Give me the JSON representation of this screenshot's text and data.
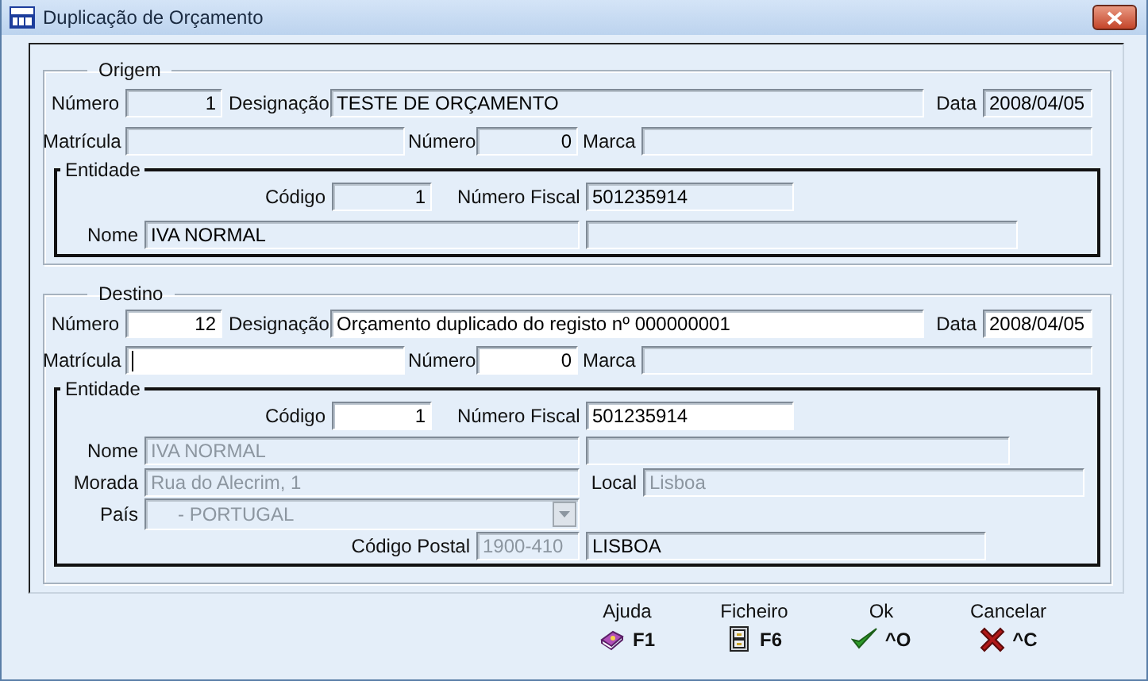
{
  "window": {
    "title": "Duplicação de Orçamento"
  },
  "sections": [
    {
      "title": "Origem",
      "numero": {
        "label": "Número",
        "value": "1",
        "editable": false,
        "disabled": false
      },
      "designacao": {
        "label": "Designação",
        "value": "TESTE DE ORÇAMENTO",
        "editable": false,
        "disabled": false
      },
      "data": {
        "label": "Data",
        "value": "2008/04/05",
        "editable": false,
        "disabled": false
      },
      "matricula": {
        "label": "Matrícula",
        "editable": false,
        "focused": false
      },
      "numero_veiculo": {
        "label": "Número",
        "value": "0",
        "editable": false,
        "disabled": false
      },
      "marca": {
        "label": "Marca",
        "editable": false
      },
      "entidade": {
        "title": "Entidade",
        "codigo": {
          "label": "Código",
          "value": "1",
          "editable": false,
          "disabled": false
        },
        "numero_fiscal": {
          "label": "Número Fiscal",
          "value": "501235914",
          "editable": false,
          "disabled": false
        },
        "nome": {
          "label": "Nome",
          "value": "IVA NORMAL",
          "editable": false,
          "disabled": false
        },
        "nome_2": {
          "editable": false
        }
      }
    },
    {
      "title": "Destino",
      "numero": {
        "label": "Número",
        "value": "12",
        "editable": true,
        "disabled": false
      },
      "designacao": {
        "label": "Designação",
        "value": "Orçamento duplicado do registo nº 000000001",
        "editable": true,
        "disabled": false
      },
      "data": {
        "label": "Data",
        "value": "2008/04/05",
        "editable": true,
        "disabled": false
      },
      "matricula": {
        "label": "Matrícula",
        "editable": true,
        "focused": true
      },
      "numero_veiculo": {
        "label": "Número",
        "value": "0",
        "editable": true,
        "disabled": false
      },
      "marca": {
        "label": "Marca",
        "editable": false
      },
      "entidade": {
        "title": "Entidade",
        "codigo": {
          "label": "Código",
          "value": "1",
          "editable": true,
          "disabled": false
        },
        "numero_fiscal": {
          "label": "Número Fiscal",
          "value": "501235914",
          "editable": true,
          "disabled": false
        },
        "nome": {
          "label": "Nome",
          "value": "IVA NORMAL",
          "editable": false,
          "disabled": true
        },
        "nome_2": {
          "editable": false
        },
        "morada": {
          "label": "Morada",
          "value": "Rua do Alecrim, 1",
          "editable": false,
          "disabled": true
        },
        "local": {
          "label": "Local",
          "value": "Lisboa",
          "editable": false,
          "disabled": true
        },
        "pais": {
          "label": "País",
          "value": "- PORTUGAL",
          "editable": false,
          "disabled": true
        },
        "codigo_postal": {
          "label": "Código Postal",
          "value": "1900-410",
          "editable": false,
          "disabled": true
        },
        "localidade": {
          "value": "LISBOA",
          "editable": false,
          "disabled": false
        }
      }
    }
  ],
  "buttons": [
    {
      "kind": "help",
      "label": "Ajuda",
      "key": "F1"
    },
    {
      "kind": "file",
      "label": "Ficheiro",
      "key": "F6"
    },
    {
      "kind": "ok",
      "label": "Ok",
      "key": "^O"
    },
    {
      "kind": "cancel",
      "label": "Cancelar",
      "key": "^C"
    }
  ]
}
